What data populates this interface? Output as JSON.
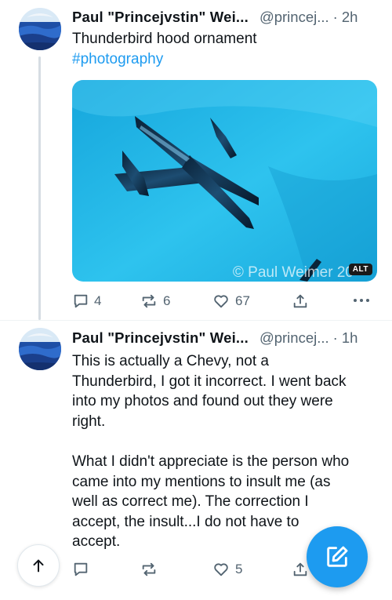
{
  "posts": [
    {
      "author": "Paul \"Princejvstin\" Wei...",
      "handle": "@princej...",
      "separator": "·",
      "time": "2h",
      "text": "Thunderbird hood ornament",
      "hashtag": "#photography",
      "media": {
        "watermark": "© Paul Weimer 20",
        "alt_label": "ALT"
      },
      "stats": {
        "replies": "4",
        "reposts": "6",
        "likes": "67"
      }
    },
    {
      "author": "Paul \"Princejvstin\" Wei...",
      "handle": "@princej...",
      "separator": "·",
      "time": "1h",
      "text_lines": [
        "This is actually a Chevy, not a",
        "Thunderbird, I got it incorrect. I went back",
        "into my photos and found out they were",
        "right.",
        "",
        "What I didn't appreciate is the person who",
        "came into my mentions to insult me (as",
        "well as correct me). The correction I",
        "accept, the insult...I do not have to",
        "accept."
      ],
      "stats": {
        "likes": "5"
      }
    }
  ],
  "colors": {
    "accent": "#1d9bf0",
    "muted": "#536471",
    "text": "#0f1419"
  },
  "icons": {
    "reply": "speech-bubble",
    "repost": "repost-arrows",
    "like": "heart",
    "share": "share-up-arrow",
    "more": "ellipsis",
    "scroll_top": "arrow-up",
    "compose": "pencil-square"
  }
}
